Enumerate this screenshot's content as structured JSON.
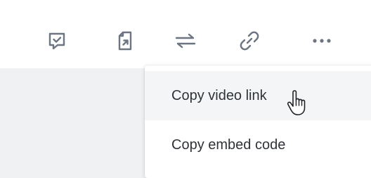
{
  "toolbar": {
    "icons": [
      "feedback-check-icon",
      "share-document-icon",
      "swap-arrows-icon",
      "link-icon",
      "more-icon"
    ]
  },
  "menu": {
    "items": [
      {
        "label": "Copy video link",
        "hovered": true
      },
      {
        "label": "Copy embed code",
        "hovered": false
      }
    ]
  },
  "colors": {
    "icon": "#6c7580",
    "menu_text": "#2f3338",
    "hover_bg": "#f4f5f7",
    "page_bg": "#f0f1f3"
  }
}
